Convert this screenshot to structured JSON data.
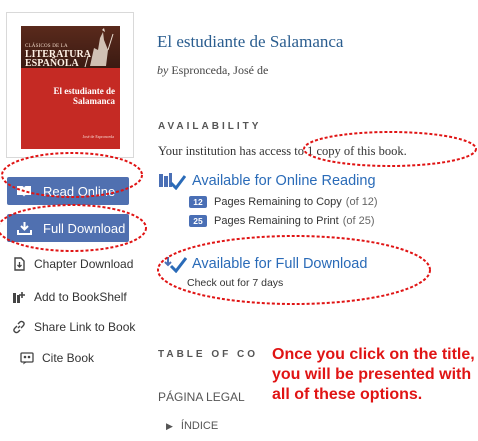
{
  "cover": {
    "series": "CLÁSICOS DE LA",
    "collection": "LITERATURA ESPAÑOLA",
    "title": "El estudiante de Salamanca",
    "author": "José de Espronceda"
  },
  "sidebar": {
    "read_online": "Read Online",
    "full_download": "Full Download",
    "chapter_download": "Chapter Download",
    "add_bookshelf": "Add to BookShelf",
    "share_link": "Share Link to Book",
    "cite_book": "Cite Book"
  },
  "book": {
    "title": "El estudiante de Salamanca",
    "by_prefix": "by",
    "author": "Espronceda, José de"
  },
  "availability": {
    "heading": "AVAILABILITY",
    "text": "Your institution has access to 1 copy of this book.",
    "online_title": "Available for Online Reading",
    "copy_count": "12",
    "copy_label": "Pages Remaining to Copy",
    "copy_of": "(of 12)",
    "print_count": "25",
    "print_label": "Pages Remaining to Print",
    "print_of": "(of 25)",
    "download_title": "Available for Full Download",
    "checkout": "Check out for 7 days"
  },
  "toc": {
    "heading": "TABLE OF CO",
    "item_1": "PÁGINA LEGAL",
    "item_2": "ÍNDICE"
  },
  "annotation": {
    "text": "Once you click on the title, you will be presented with all of these options."
  },
  "colors": {
    "button_blue": "#5070b0",
    "link_blue": "#2a6bb8",
    "annotation_red": "#e01414",
    "cover_red": "#c52a24"
  }
}
